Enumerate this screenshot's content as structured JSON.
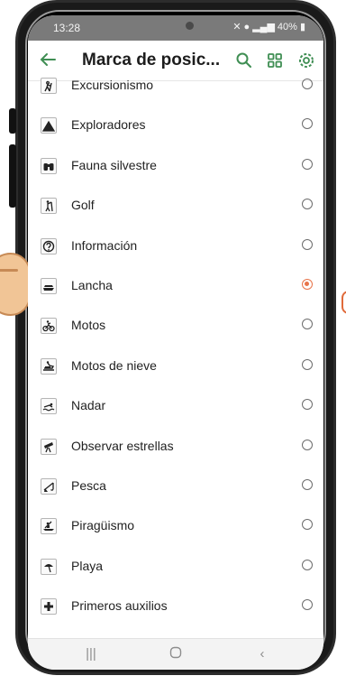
{
  "status": {
    "time": "13:28",
    "battery": "40%"
  },
  "appbar": {
    "title": "Marca de posic...",
    "back_icon": "arrow-left-icon",
    "search_icon": "search-icon",
    "grid_icon": "grid-icon",
    "settings_icon": "gear-icon"
  },
  "colors": {
    "accent": "#3f8e53",
    "selected": "#e8744a"
  },
  "items": [
    {
      "label": "Excursionismo",
      "icon": "hiker-icon",
      "selected": false
    },
    {
      "label": "Exploradores",
      "icon": "tent-icon",
      "selected": false
    },
    {
      "label": "Fauna silvestre",
      "icon": "binoculars-icon",
      "selected": false
    },
    {
      "label": "Golf",
      "icon": "golfer-icon",
      "selected": false
    },
    {
      "label": "Información",
      "icon": "question-icon",
      "selected": false
    },
    {
      "label": "Lancha",
      "icon": "boat-icon",
      "selected": true
    },
    {
      "label": "Motos",
      "icon": "motorbike-icon",
      "selected": false
    },
    {
      "label": "Motos de nieve",
      "icon": "snowmobile-icon",
      "selected": false
    },
    {
      "label": "Nadar",
      "icon": "swimmer-icon",
      "selected": false
    },
    {
      "label": "Observar estrellas",
      "icon": "telescope-icon",
      "selected": false
    },
    {
      "label": "Pesca",
      "icon": "fishing-icon",
      "selected": false
    },
    {
      "label": "Piragüismo",
      "icon": "kayak-icon",
      "selected": false
    },
    {
      "label": "Playa",
      "icon": "umbrella-icon",
      "selected": false
    },
    {
      "label": "Primeros auxilios",
      "icon": "first-aid-icon",
      "selected": false
    }
  ],
  "navbar": {
    "recents_icon": "recents-icon",
    "home_icon": "home-icon",
    "back_icon": "nav-back-icon"
  }
}
